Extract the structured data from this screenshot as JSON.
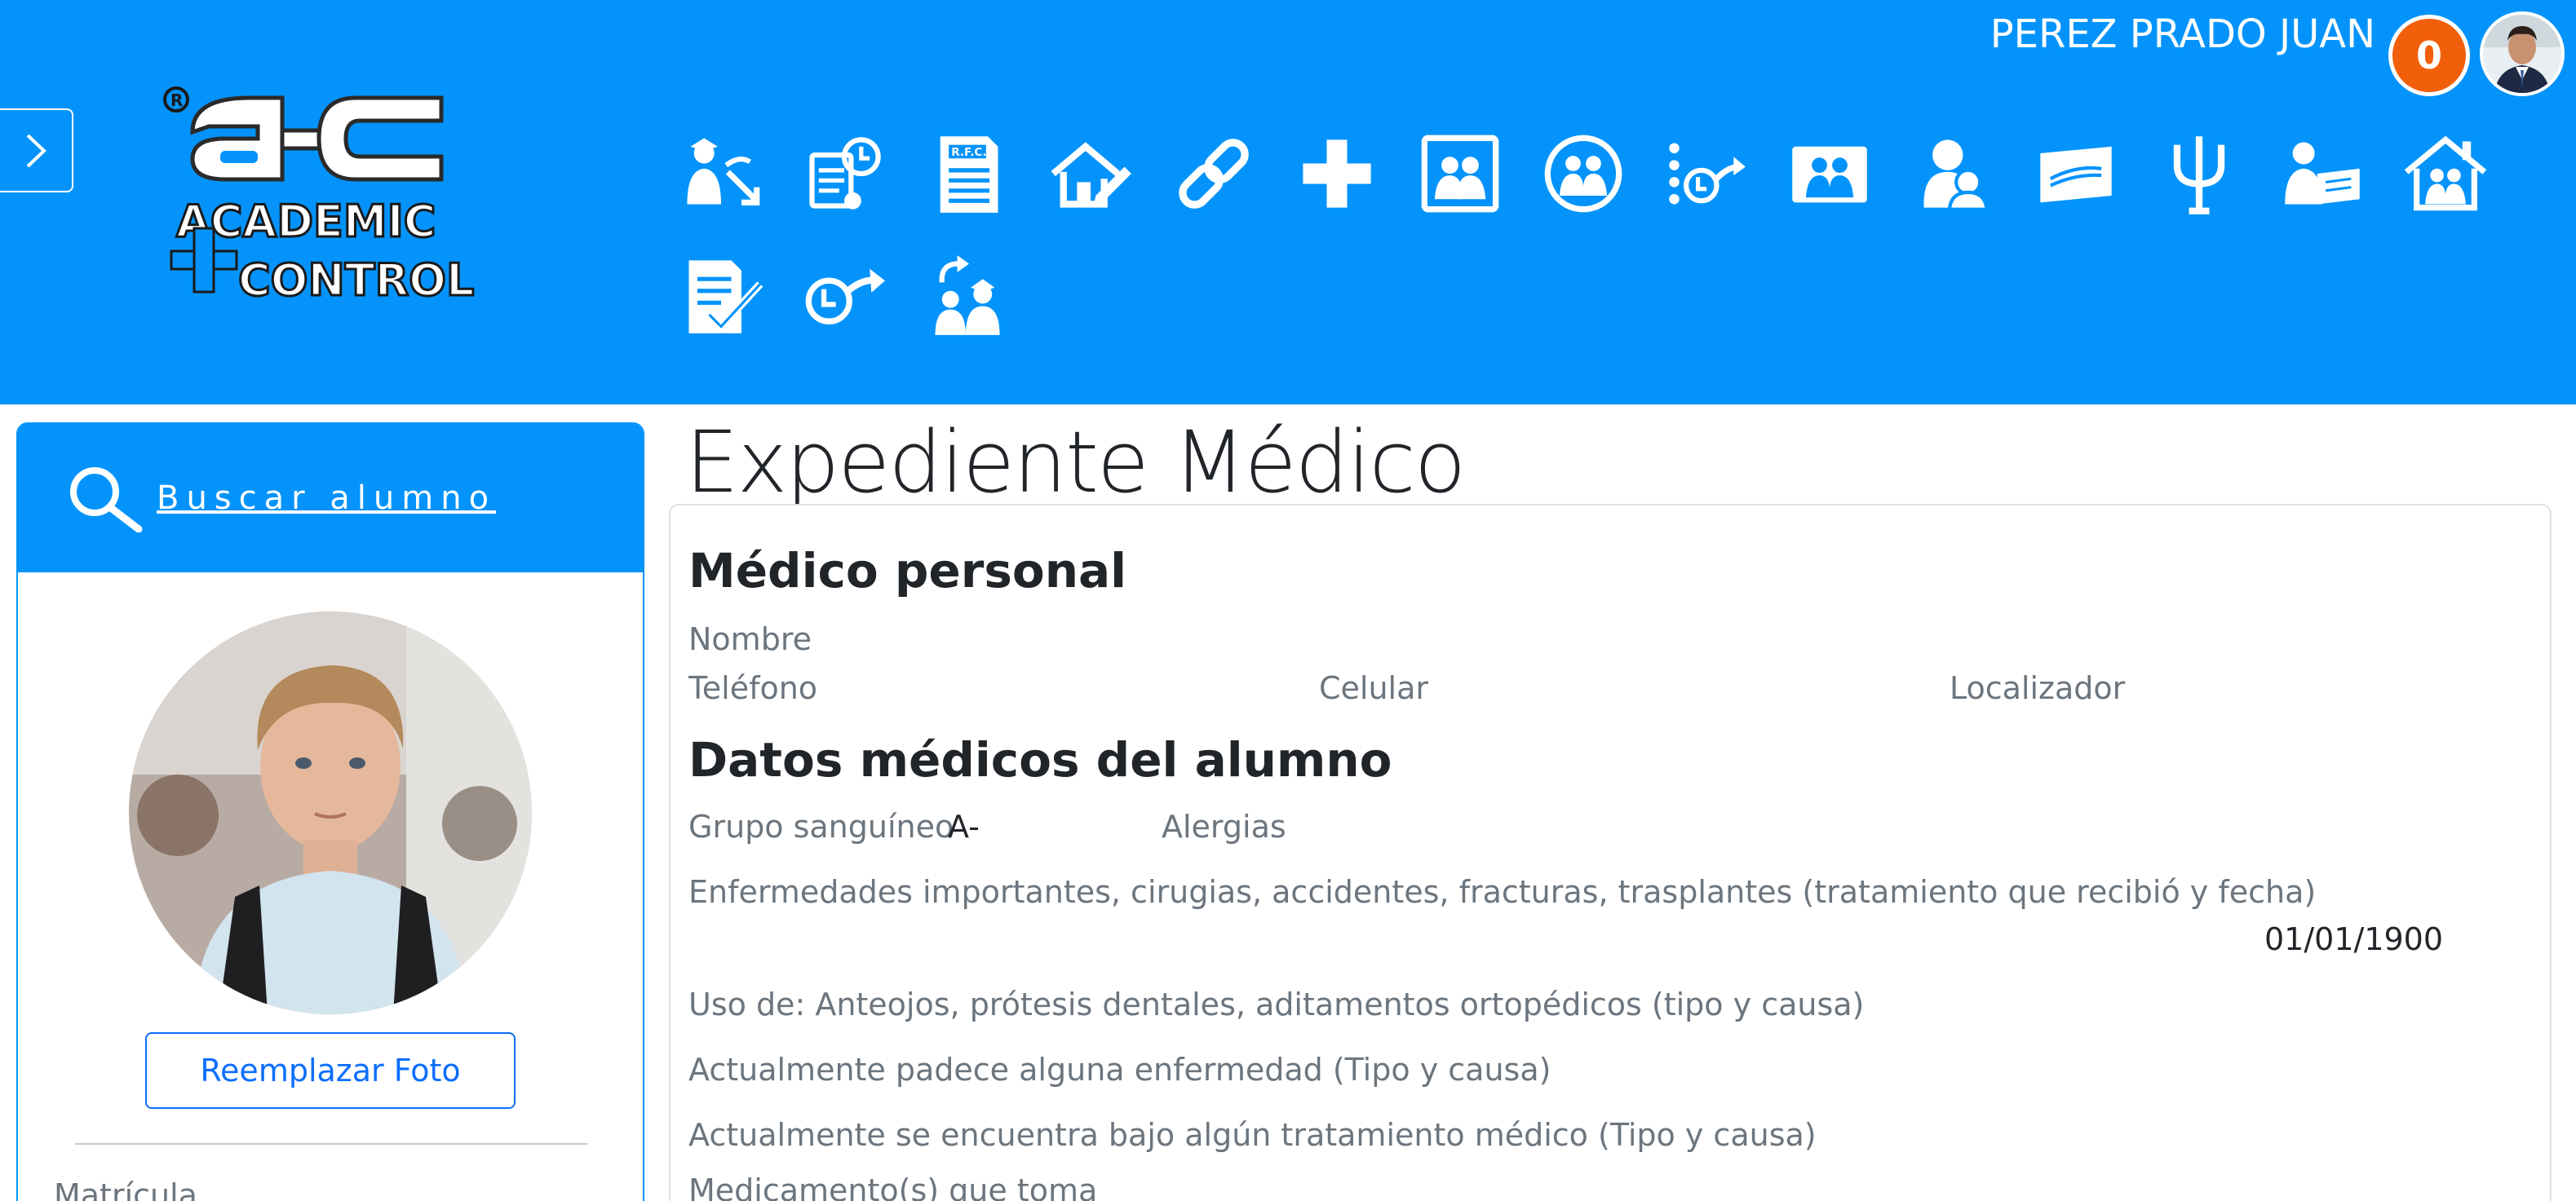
{
  "header": {
    "user_name": "PEREZ PRADO JUAN",
    "notification_count": "0",
    "logo_text": {
      "line1": "ACADEMIC",
      "line2": "CONTROL",
      "mark": "a-c"
    },
    "nav_icons_row1": [
      "student-transfer-icon",
      "billing-schedule-icon",
      "rfc-document-icon",
      "home-edit-icon",
      "link-icon",
      "medical-cross-icon",
      "family-photo-icon",
      "family-circle-icon",
      "schedule-forward-icon",
      "parents-card-icon",
      "student-hug-icon",
      "id-card-icon",
      "psychology-icon",
      "teacher-board-icon",
      "family-home-icon"
    ],
    "nav_icons_row2": [
      "checklist-icon",
      "clock-forward-icon",
      "student-return-icon"
    ]
  },
  "sidebar": {
    "search_label": "Buscar alumno",
    "replace_photo_label": "Reemplazar Foto",
    "matricula_label": "Matrícula"
  },
  "main": {
    "page_title": "Expediente Médico",
    "personal_doctor": {
      "title": "Médico personal",
      "name_label": "Nombre",
      "phone_label": "Teléfono",
      "cell_label": "Celular",
      "locator_label": "Localizador"
    },
    "medical_data": {
      "title": "Datos médicos del alumno",
      "blood_type_label": "Grupo sanguíneo",
      "blood_type_value": "A-",
      "allergies_label": "Alergias",
      "illnesses_label": "Enfermedades importantes, cirugias, accidentes, fracturas, trasplantes (tratamiento que recibió y fecha)",
      "illnesses_date": "01/01/1900",
      "devices_label": "Uso de: Anteojos, prótesis dentales, aditamentos ortopédicos (tipo y causa)",
      "current_illness_label": "Actualmente padece alguna enfermedad (Tipo y causa)",
      "current_treatment_label": "Actualmente se encuentra bajo algún tratamiento médico (Tipo y causa)",
      "medications_label": "Medicamento(s) que toma"
    }
  },
  "colors": {
    "header_bg": "#0393fb",
    "badge": "#f25f0b",
    "button_border": "#0d6efd"
  }
}
